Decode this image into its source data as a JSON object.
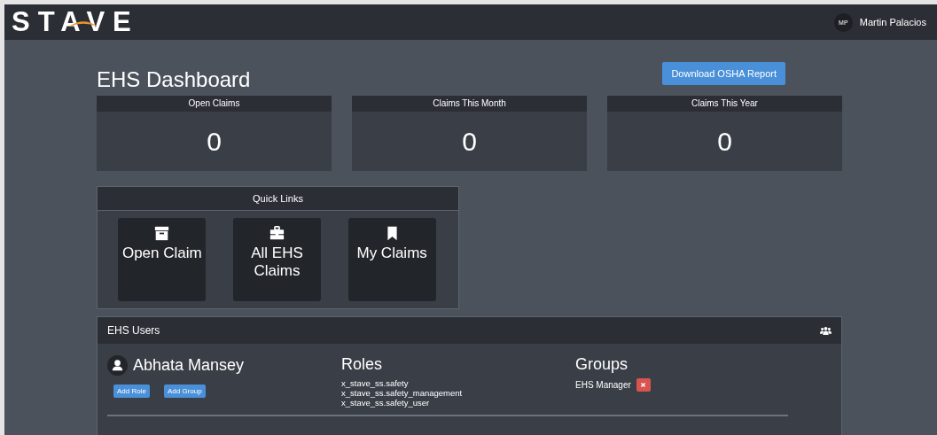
{
  "header": {
    "logo": "STAVE",
    "user": {
      "initials": "MP",
      "name": "Martin Palacios"
    }
  },
  "page": {
    "title": "EHS Dashboard",
    "action": "Download OSHA Report"
  },
  "stats": [
    {
      "label": "Open Claims",
      "value": "0"
    },
    {
      "label": "Claims This Month",
      "value": "0"
    },
    {
      "label": "Claims This Year",
      "value": "0"
    }
  ],
  "quick_links": {
    "title": "Quick Links",
    "items": [
      {
        "kind": "box",
        "label": "Open Claim"
      },
      {
        "kind": "briefcase",
        "label": "All EHS Claims"
      },
      {
        "kind": "bookmark",
        "label": "My Claims"
      }
    ]
  },
  "users_panel": {
    "title": "EHS Users",
    "users": [
      {
        "name": "Abhata Mansey",
        "buttons": [
          "Add Role",
          "Add Group"
        ],
        "roles_heading": "Roles",
        "roles": [
          "x_stave_ss.safety",
          "x_stave_ss.safety_management",
          "x_stave_ss.safety_user"
        ],
        "groups_heading": "Groups",
        "groups": [
          "EHS Manager"
        ]
      }
    ]
  }
}
